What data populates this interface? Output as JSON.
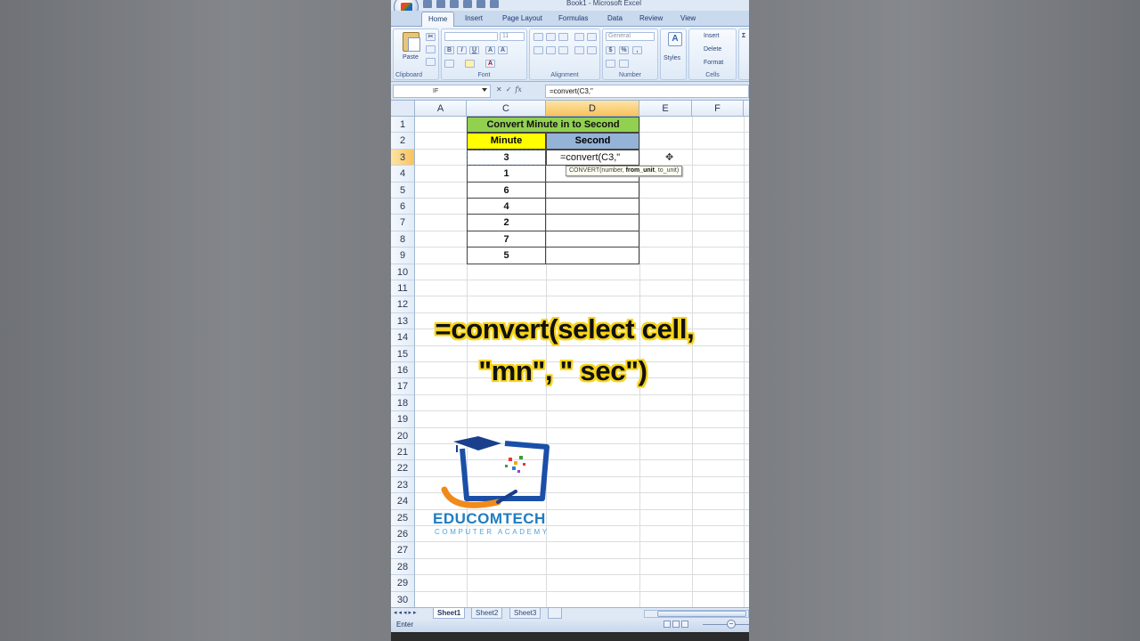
{
  "window": {
    "title": "Book1 - Microsoft Excel"
  },
  "ribbon": {
    "tabs": [
      "Home",
      "Insert",
      "Page Layout",
      "Formulas",
      "Data",
      "Review",
      "View"
    ],
    "active_tab": "Home",
    "groups": {
      "clipboard": {
        "label": "Clipboard",
        "paste": "Paste"
      },
      "font": {
        "label": "Font",
        "font_size": "11"
      },
      "alignment": {
        "label": "Alignment"
      },
      "number": {
        "label": "Number",
        "format": "General"
      },
      "styles": {
        "label": "Styles"
      },
      "cells": {
        "label": "Cells",
        "insert": "Insert",
        "delete": "Delete",
        "format": "Format"
      }
    }
  },
  "formula_bar": {
    "name_box": "IF",
    "fx": "fx",
    "formula": "=convert(C3,\""
  },
  "columns": [
    "A",
    "C",
    "D",
    "E",
    "F"
  ],
  "rows": [
    "1",
    "2",
    "3",
    "4",
    "5",
    "6",
    "7",
    "8",
    "9",
    "10",
    "11",
    "12",
    "13",
    "14",
    "15",
    "16",
    "17",
    "18",
    "19",
    "20",
    "21",
    "22",
    "23",
    "24",
    "25",
    "26",
    "27",
    "28",
    "29",
    "30"
  ],
  "sheet": {
    "title": "Convert Minute in to Second",
    "header_minute": "Minute",
    "header_second": "Second",
    "minutes": [
      "3",
      "1",
      "6",
      "4",
      "2",
      "7",
      "5"
    ],
    "editing_cell": "=convert(C3,\"",
    "tooltip": {
      "prefix": "CONVERT(number, ",
      "bold": "from_unit",
      "suffix": ", to_unit)"
    }
  },
  "overlay": {
    "line1": "=convert(select cell,",
    "line2": "\"mn\", \" sec\")"
  },
  "logo": {
    "name": "EDUCOMTECH",
    "sub": "COMPUTER ACADEMY"
  },
  "sheet_tabs": [
    "Sheet1",
    "Sheet2",
    "Sheet3"
  ],
  "status": {
    "mode": "Enter"
  },
  "colors": {
    "title_fill": "#92d050",
    "minute_fill": "#ffff00",
    "second_fill": "#95b3d7",
    "overlay_outline": "#f7d41b"
  }
}
